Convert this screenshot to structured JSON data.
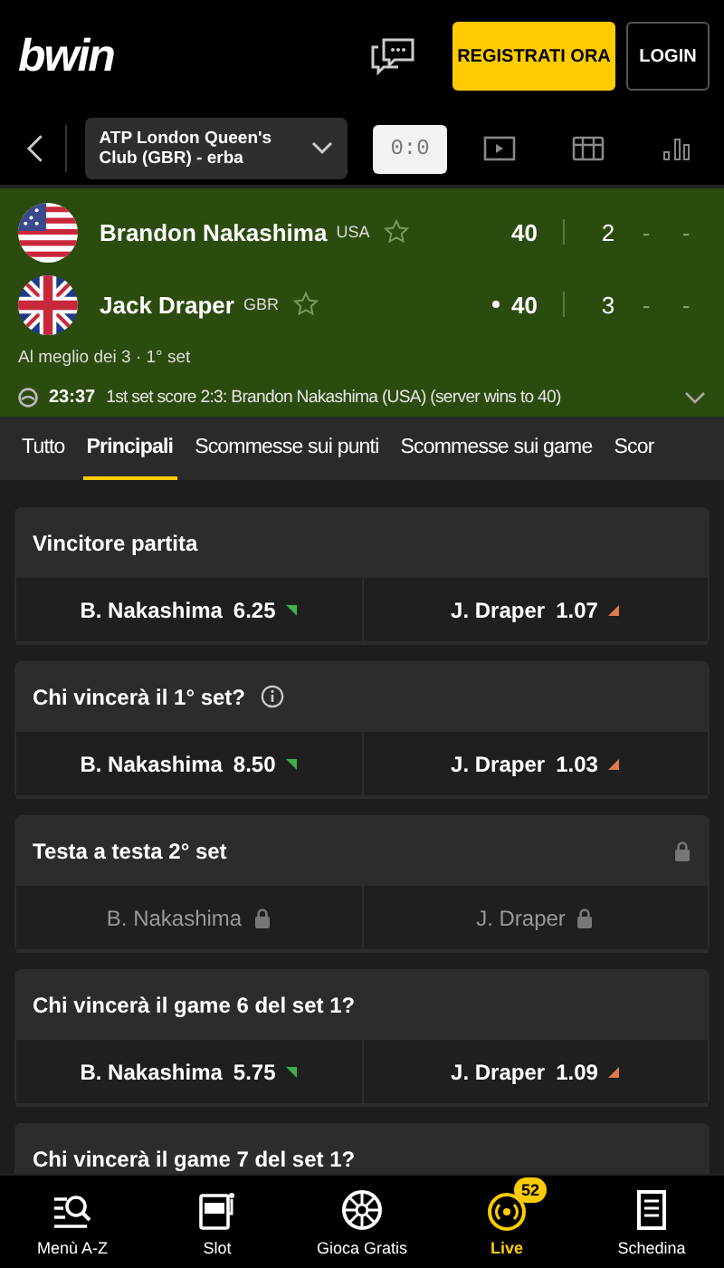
{
  "header": {
    "logo": "bwin",
    "register_button": "REGISTRATI ORA",
    "login_button": "LOGIN"
  },
  "event_nav": {
    "competition": "ATP London Queen's Club (GBR) - erba",
    "views": [
      {
        "kind": "score",
        "label": "0:0",
        "selected": true
      },
      {
        "kind": "video",
        "selected": false
      },
      {
        "kind": "grid",
        "selected": false
      },
      {
        "kind": "stats",
        "selected": false
      }
    ]
  },
  "scoreboard": {
    "players": [
      {
        "name": "Brandon Nakashima",
        "country": "USA",
        "favorite": false,
        "serving": false,
        "points": "40",
        "sets": [
          "2",
          "-",
          "-"
        ]
      },
      {
        "name": "Jack Draper",
        "country": "GBR",
        "favorite": false,
        "serving": true,
        "points": "40",
        "sets": [
          "3",
          "-",
          "-"
        ]
      }
    ],
    "format": "Al meglio dei 3 · 1° set",
    "event_time": "23:37",
    "event_text": "1st set score 2:3: Brandon Nakashima (USA) (server wins to 40)"
  },
  "tabs": [
    {
      "label": "Tutto",
      "selected": false
    },
    {
      "label": "Principali",
      "selected": true
    },
    {
      "label": "Scommesse sui punti",
      "selected": false
    },
    {
      "label": "Scommesse sui game",
      "selected": false
    },
    {
      "label": "Scor",
      "selected": false
    }
  ],
  "markets": [
    {
      "title": "Vincitore partita",
      "info": false,
      "locked": false,
      "options": [
        {
          "name": "B. Nakashima",
          "odds": "6.25",
          "odds_up": true,
          "locked": false
        },
        {
          "name": "J. Draper",
          "odds": "1.07",
          "odds_up": false,
          "locked": false
        }
      ]
    },
    {
      "title": "Chi vincerà il 1° set?",
      "info": true,
      "locked": false,
      "options": [
        {
          "name": "B. Nakashima",
          "odds": "8.50",
          "odds_up": true,
          "locked": false
        },
        {
          "name": "J. Draper",
          "odds": "1.03",
          "odds_up": false,
          "locked": false
        }
      ]
    },
    {
      "title": "Testa a testa 2° set",
      "info": false,
      "locked": true,
      "options": [
        {
          "name": "B. Nakashima",
          "locked": true
        },
        {
          "name": "J. Draper",
          "locked": true
        }
      ]
    },
    {
      "title": "Chi vincerà il game 6 del set 1?",
      "info": false,
      "locked": false,
      "options": [
        {
          "name": "B. Nakashima",
          "odds": "5.75",
          "odds_up": true,
          "locked": false
        },
        {
          "name": "J. Draper",
          "odds": "1.09",
          "odds_up": false,
          "locked": false
        }
      ]
    },
    {
      "title": "Chi vincerà il game 7 del set 1?",
      "info": false,
      "locked": false
    }
  ],
  "bottom_nav": [
    {
      "kind": "menu",
      "label": "Menù A-Z",
      "selected": false
    },
    {
      "kind": "slot",
      "label": "Slot",
      "selected": false
    },
    {
      "kind": "wheel",
      "label": "Gioca Gratis",
      "selected": false
    },
    {
      "kind": "live",
      "label": "Live",
      "badge": "52",
      "selected": true
    },
    {
      "kind": "slip",
      "label": "Schedina",
      "selected": false
    }
  ]
}
